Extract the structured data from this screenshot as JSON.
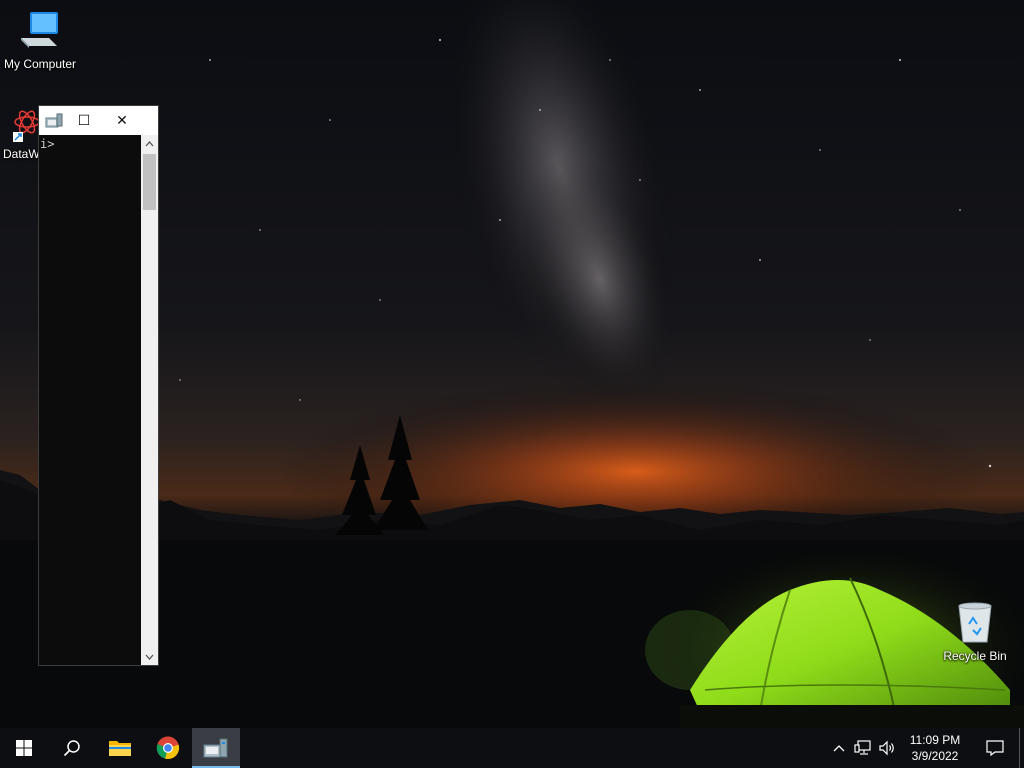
{
  "desktop": {
    "icons": [
      {
        "label": "My Computer",
        "icon": "computer-icon"
      },
      {
        "label": "DataW",
        "icon": "datawarrior-icon"
      },
      {
        "label": "Recycle Bin",
        "icon": "recycle-bin-icon"
      }
    ]
  },
  "console_window": {
    "app_icon": "console-app-icon",
    "maximize_glyph": "☐",
    "close_glyph": "✕",
    "prompt": "i>"
  },
  "taskbar": {
    "start_icon": "windows-start-icon",
    "search_icon": "search-icon",
    "apps": [
      {
        "name": "file-explorer",
        "icon": "folder-icon",
        "active": false
      },
      {
        "name": "chrome",
        "icon": "chrome-icon",
        "active": false
      },
      {
        "name": "console-app",
        "icon": "console-app-icon",
        "active": true
      }
    ],
    "tray": {
      "chevron": "^",
      "time": "11:09 PM",
      "date": "3/9/2022"
    }
  },
  "colors": {
    "taskbar_bg": "#0d0e11",
    "active_indicator": "#76b9ed",
    "tent_green": "#8fdc1a",
    "horizon_orange": "#e0601a"
  }
}
